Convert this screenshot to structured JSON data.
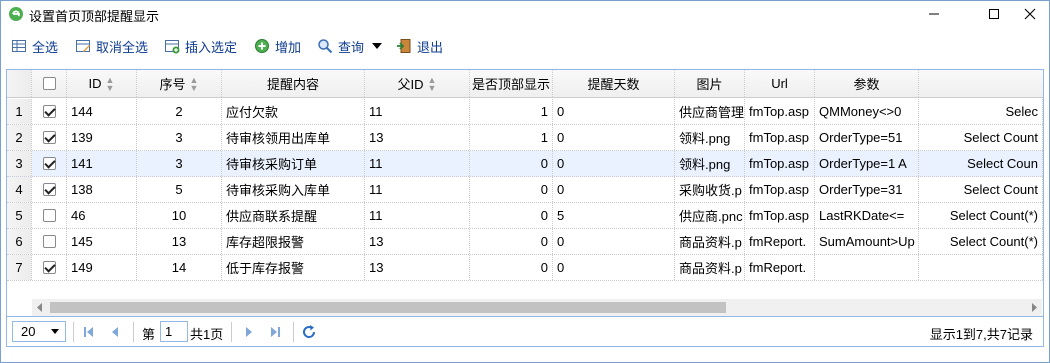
{
  "window": {
    "title": "设置首页顶部提醒显示"
  },
  "toolbar": {
    "select_all": "全选",
    "deselect_all": "取消全选",
    "insert_selected": "插入选定",
    "add": "增加",
    "query": "查询",
    "exit": "退出"
  },
  "grid": {
    "headers": {
      "id": "ID",
      "seq": "序号",
      "content": "提醒内容",
      "parent_id": "父ID",
      "top_display": "是否顶部显示",
      "remind_days": "提醒天数",
      "image": "图片",
      "url": "Url",
      "params": "参数"
    },
    "rows": [
      {
        "rownum": "1",
        "checked": true,
        "id": "144",
        "seq": "2",
        "content": "应付欠款",
        "parent_id": "11",
        "top_display": "1",
        "remind_days": "0",
        "image": "供应商管理",
        "url": "fmTop.asp",
        "params": "QMMoney<>0",
        "extra": "Selec"
      },
      {
        "rownum": "2",
        "checked": true,
        "id": "139",
        "seq": "3",
        "content": "待审核领用出库单",
        "parent_id": "13",
        "top_display": "1",
        "remind_days": "0",
        "image": "领料.png",
        "url": "fmTop.asp",
        "params": "OrderType=51 ",
        "extra": "Select Count"
      },
      {
        "rownum": "3",
        "checked": true,
        "id": "141",
        "seq": "3",
        "content": "待审核采购订单",
        "parent_id": "11",
        "top_display": "0",
        "remind_days": "0",
        "image": "领料.png",
        "url": "fmTop.asp",
        "params": "OrderType=1 A",
        "extra": "Select Coun"
      },
      {
        "rownum": "4",
        "checked": true,
        "id": "138",
        "seq": "5",
        "content": "待审核采购入库单",
        "parent_id": "11",
        "top_display": "0",
        "remind_days": "0",
        "image": "采购收货.p",
        "url": "fmTop.asp",
        "params": "OrderType=31 ",
        "extra": "Select Count"
      },
      {
        "rownum": "5",
        "checked": false,
        "id": "46",
        "seq": "10",
        "content": "供应商联系提醒",
        "parent_id": "11",
        "top_display": "0",
        "remind_days": "5",
        "image": "供应商.pnc",
        "url": "fmTop.asp",
        "params": "LastRKDate<= ",
        "extra": "Select Count(*)"
      },
      {
        "rownum": "6",
        "checked": false,
        "id": "145",
        "seq": "13",
        "content": "库存超限报警",
        "parent_id": "13",
        "top_display": "0",
        "remind_days": "0",
        "image": "商品资料.p",
        "url": "fmReport.",
        "params": "SumAmount>Up",
        "extra": "Select Count(*)"
      },
      {
        "rownum": "7",
        "checked": true,
        "id": "149",
        "seq": "14",
        "content": "低于库存报警",
        "parent_id": "13",
        "top_display": "0",
        "remind_days": "0",
        "image": "商品资料.p",
        "url": "fmReport.",
        "params": "",
        "extra": ""
      }
    ],
    "selected_row_index": 2
  },
  "pager": {
    "page_size": "20",
    "page_label": "第",
    "page_value": "1",
    "total_pages": "共1页",
    "summary": "显示1到7,共7记录"
  },
  "colors": {
    "accent_border": "#95b8e7",
    "link_text": "#0f3c91",
    "selected_row": "#eaf2ff"
  }
}
